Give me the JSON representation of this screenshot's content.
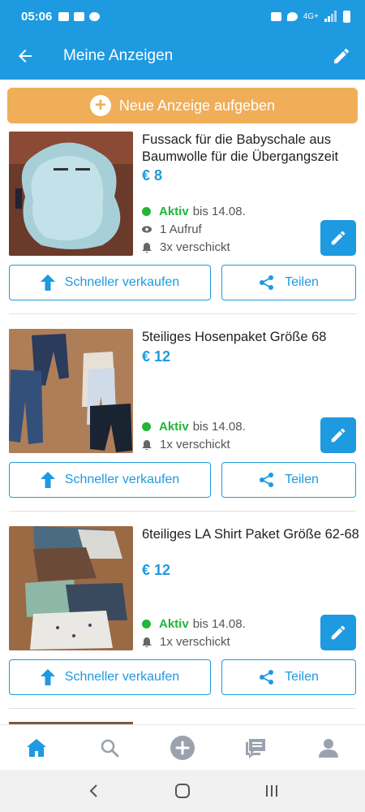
{
  "status_bar": {
    "time": "05:06",
    "network": "4G+"
  },
  "app_bar": {
    "title": "Meine Anzeigen"
  },
  "new_ad_button": {
    "label": "Neue Anzeige aufgeben"
  },
  "colors": {
    "primary": "#1e9ae0",
    "accent": "#f0ae59",
    "active": "#22b53a"
  },
  "listings": [
    {
      "title": "Fussack für die Babyschale aus Baumwolle für die Übergangszeit",
      "price": "€ 8",
      "status": "Aktiv",
      "until": "bis 14.08.",
      "views": "1 Aufruf",
      "sent": "3x verschickt",
      "sell_faster": "Schneller verkaufen",
      "share": "Teilen"
    },
    {
      "title": "5teiliges Hosenpaket Größe 68",
      "price": "€ 12",
      "status": "Aktiv",
      "until": "bis 14.08.",
      "sent": "1x verschickt",
      "sell_faster": "Schneller verkaufen",
      "share": "Teilen"
    },
    {
      "title": "6teiliges LA Shirt Paket Größe 62-68",
      "price": "€ 12",
      "status": "Aktiv",
      "until": "bis 14.08.",
      "sent": "1x verschickt",
      "sell_faster": "Schneller verkaufen",
      "share": "Teilen"
    }
  ],
  "bottom_nav": [
    "home-icon",
    "search-icon",
    "add-icon",
    "messages-icon",
    "profile-icon"
  ]
}
